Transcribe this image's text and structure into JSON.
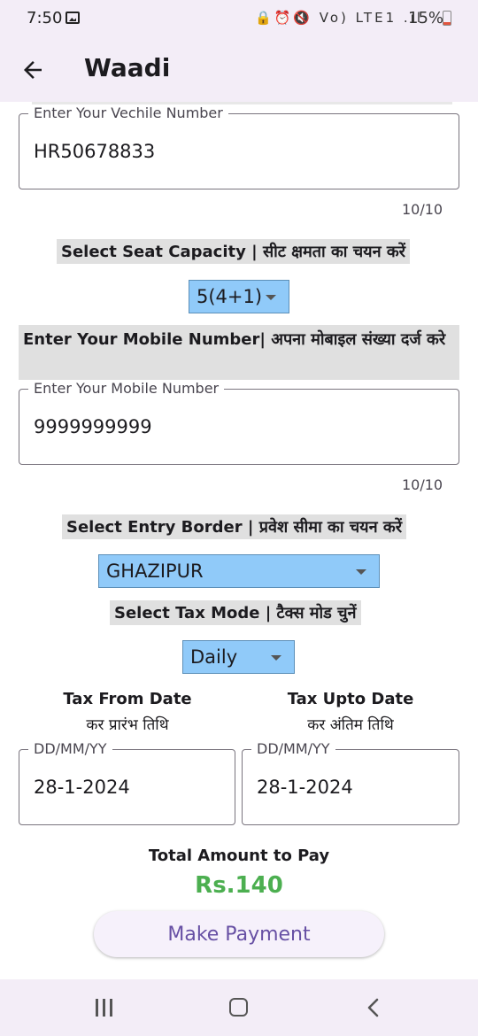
{
  "status_bar": {
    "time": "7:50",
    "icons": "🔒⏰🔇 Vo) LTE1 .ıl",
    "battery": "15%"
  },
  "app_bar": {
    "title": "Waadi"
  },
  "vehicle": {
    "label": "Enter Your Vechile Number",
    "value": "HR50678833",
    "counter": "10/10"
  },
  "seat": {
    "label": "Select Seat Capacity | सीट क्षमता का चयन करें",
    "value": "5(4+1)"
  },
  "mobile": {
    "heading": "Enter Your Mobile Number| अपना मोबाइल संख्या दर्ज करे",
    "label": "Enter Your Mobile Number",
    "value": "9999999999",
    "counter": "10/10"
  },
  "border": {
    "label": "Select Entry Border | प्रवेश सीमा का चयन करें",
    "value": "GHAZIPUR"
  },
  "tax_mode": {
    "label": "Select Tax Mode | टैक्स मोड चुनें",
    "value": "Daily"
  },
  "from_date": {
    "heading_en": "Tax From Date",
    "heading_hi": "कर प्रारंभ तिथि",
    "label": "DD/MM/YY",
    "value": "28-1-2024"
  },
  "upto_date": {
    "heading_en": "Tax Upto Date",
    "heading_hi": "कर अंतिम तिथि",
    "label": "DD/MM/YY",
    "value": "28-1-2024"
  },
  "total": {
    "label": "Total Amount to Pay",
    "amount": "Rs.140"
  },
  "pay_button": {
    "label": "Make Payment"
  },
  "colors": {
    "accent": "#6750a4",
    "amount": "#4caf50",
    "dropdown": "#90caf9",
    "bar": "#f3edf7"
  }
}
